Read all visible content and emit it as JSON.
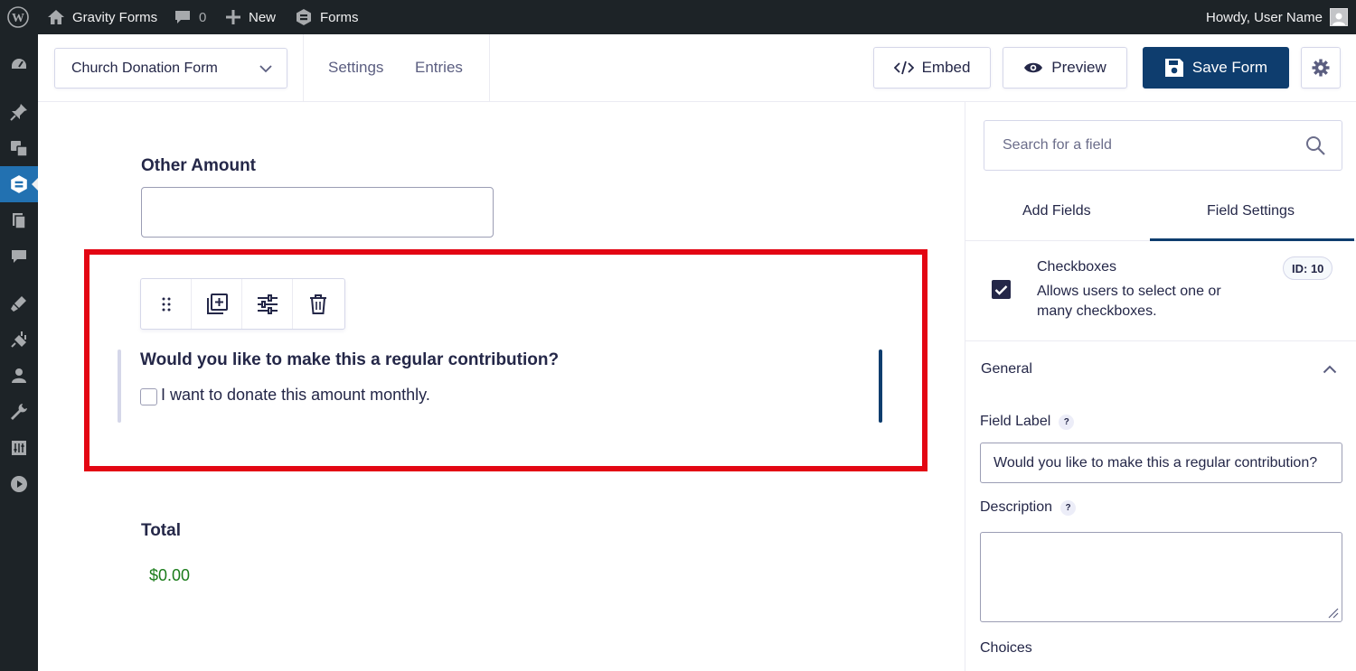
{
  "admin_bar": {
    "site_name": "Gravity Forms",
    "comments_count": "0",
    "new_label": "New",
    "forms_label": "Forms",
    "greeting": "Howdy, User Name"
  },
  "sidebar": {
    "items": [
      {
        "icon": "dashboard-icon"
      },
      {
        "icon": "pin-icon"
      },
      {
        "icon": "media-icon"
      },
      {
        "icon": "gravity-forms-icon",
        "active": true
      },
      {
        "icon": "pages-icon"
      },
      {
        "icon": "comments-icon"
      },
      {
        "icon": "appearance-icon"
      },
      {
        "icon": "plugins-icon"
      },
      {
        "icon": "users-icon"
      },
      {
        "icon": "tools-icon"
      },
      {
        "icon": "settings-icon"
      },
      {
        "icon": "play-icon"
      }
    ]
  },
  "toolbar": {
    "form_name": "Church Donation Form",
    "settings_label": "Settings",
    "entries_label": "Entries",
    "embed_label": "Embed",
    "preview_label": "Preview",
    "save_label": "Save Form"
  },
  "canvas": {
    "other_amount_label": "Other Amount",
    "other_amount_value": "",
    "selected_field_label": "Would you like to make this a regular contribution?",
    "checkbox_choice": "I want to donate this amount monthly.",
    "total_label": "Total",
    "total_value": "$0.00"
  },
  "panel": {
    "search_placeholder": "Search for a field",
    "tabs": [
      {
        "label": "Add Fields",
        "active": false
      },
      {
        "label": "Field Settings",
        "active": true
      }
    ],
    "field_type": {
      "title": "Checkboxes",
      "description": "Allows users to select one or many checkboxes.",
      "id_badge": "ID: 10"
    },
    "section_title": "General",
    "field_label_title": "Field Label",
    "field_label_value": "Would you like to make this a regular contribution?",
    "description_title": "Description",
    "description_value": "",
    "choices_title": "Choices",
    "help_glyph": "?"
  },
  "colors": {
    "primary": "#0e3d6e",
    "highlight": "#e30613",
    "total": "#1a7c1a",
    "admin_bar": "#1d2327",
    "active_menu": "#2271b1"
  }
}
